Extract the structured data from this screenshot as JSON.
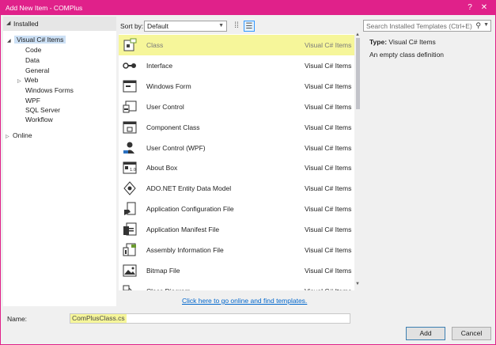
{
  "window": {
    "title": "Add New Item - COMPlus",
    "help_glyph": "?",
    "close_glyph": "✕",
    "border_color": "#e0218a"
  },
  "tree": {
    "installed_label": "Installed",
    "visual_csharp_items": "Visual C# Items",
    "children": [
      "Code",
      "Data",
      "General",
      "Web",
      "Windows Forms",
      "WPF",
      "SQL Server",
      "Workflow"
    ],
    "online_label": "Online"
  },
  "toolbar": {
    "sort_label": "Sort by:",
    "sort_value": "Default",
    "search_placeholder": "Search Installed Templates (Ctrl+E)"
  },
  "templates": [
    {
      "name": "Class",
      "category": "Visual C# Items",
      "icon": "class-icon",
      "selected": true
    },
    {
      "name": "Interface",
      "category": "Visual C# Items",
      "icon": "interface-icon"
    },
    {
      "name": "Windows Form",
      "category": "Visual C# Items",
      "icon": "windows-form-icon"
    },
    {
      "name": "User Control",
      "category": "Visual C# Items",
      "icon": "user-control-icon"
    },
    {
      "name": "Component Class",
      "category": "Visual C# Items",
      "icon": "component-class-icon"
    },
    {
      "name": "User Control (WPF)",
      "category": "Visual C# Items",
      "icon": "user-control-wpf-icon"
    },
    {
      "name": "About Box",
      "category": "Visual C# Items",
      "icon": "about-box-icon"
    },
    {
      "name": "ADO.NET Entity Data Model",
      "category": "Visual C# Items",
      "icon": "entity-data-model-icon"
    },
    {
      "name": "Application Configuration File",
      "category": "Visual C# Items",
      "icon": "config-file-icon"
    },
    {
      "name": "Application Manifest File",
      "category": "Visual C# Items",
      "icon": "manifest-file-icon"
    },
    {
      "name": "Assembly Information File",
      "category": "Visual C# Items",
      "icon": "assembly-info-icon"
    },
    {
      "name": "Bitmap File",
      "category": "Visual C# Items",
      "icon": "bitmap-file-icon"
    },
    {
      "name": "Class Diagram",
      "category": "Visual C# Items",
      "icon": "class-diagram-icon"
    }
  ],
  "online_link": "Click here to go online and find templates.",
  "details": {
    "type_label": "Type:",
    "type_value": "Visual C# Items",
    "description": "An empty class definition"
  },
  "footer": {
    "name_label": "Name:",
    "name_value": "ComPlusClass.cs",
    "add_label": "Add",
    "cancel_label": "Cancel"
  },
  "colors": {
    "accent": "#e0218a",
    "highlight": "#f6f69a",
    "link": "#0066cc"
  }
}
